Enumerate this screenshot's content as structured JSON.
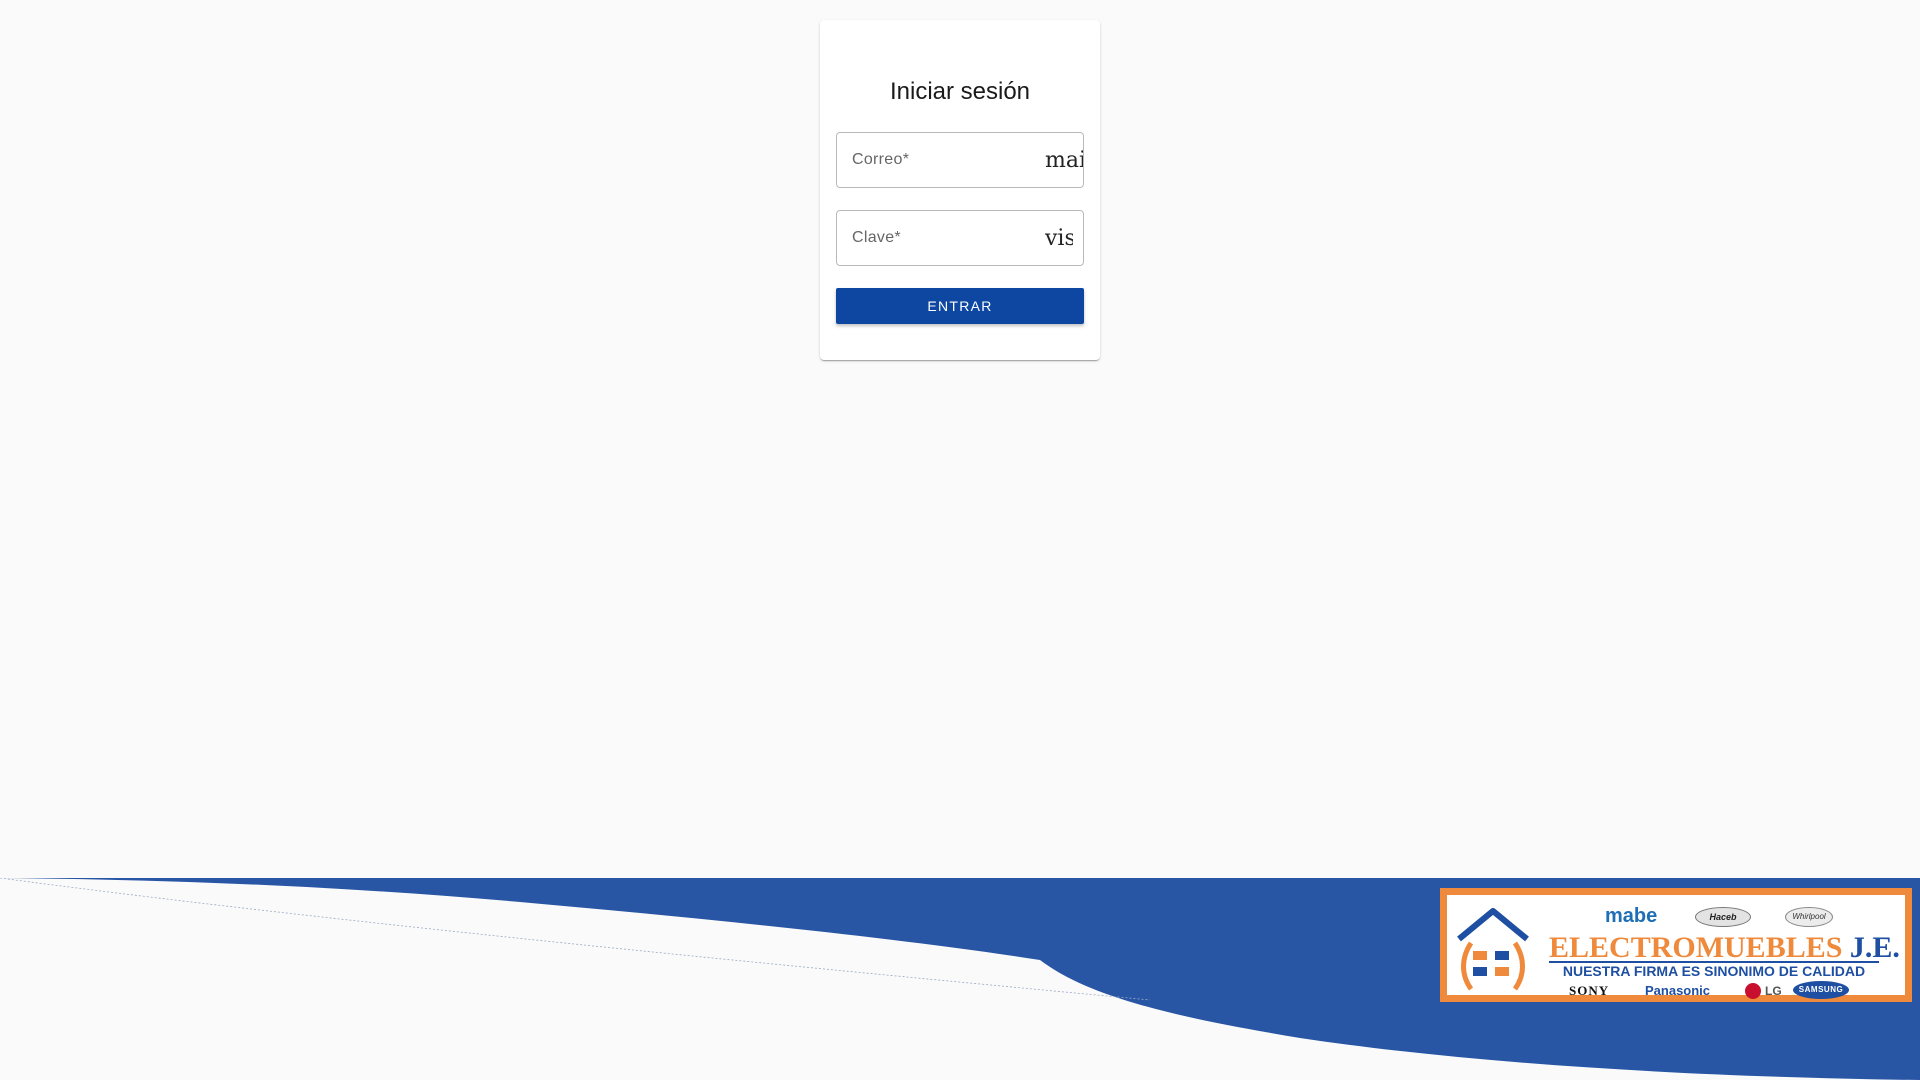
{
  "login": {
    "title": "Iniciar sesión",
    "email_label": "Correo*",
    "email_value": "",
    "email_icon": "mail",
    "password_label": "Clave*",
    "password_value": "",
    "password_icon": "visibility",
    "submit_label": "ENTRAR"
  },
  "brand": {
    "top_brand": "mabe",
    "badge_left": "Haceb",
    "badge_right": "Whirlpool",
    "name_main": "ELECTROMUEBLES",
    "name_suffix": "J.E.",
    "slogan": "NUESTRA FIRMA ES SINONIMO DE CALIDAD",
    "partner_1": "SONY",
    "partner_2": "Panasonic",
    "partner_3": "LG",
    "partner_4": "SAMSUNG"
  },
  "colors": {
    "background": "#fafafa",
    "primary_button": "#0d47a1",
    "wave_blue": "#2856a5",
    "brand_orange": "#ef8a3c"
  }
}
